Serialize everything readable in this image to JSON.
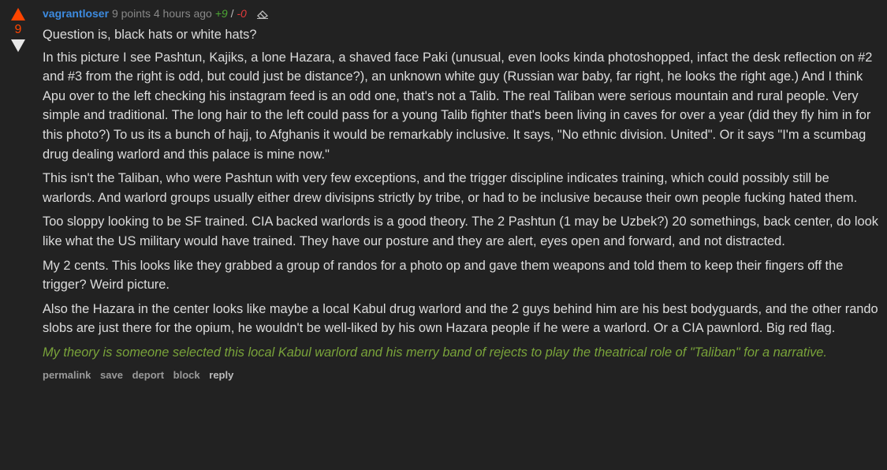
{
  "vote": {
    "score": "9",
    "upvote_color": "#ff4500",
    "downvote_color": "#e8e8e8"
  },
  "comment": {
    "author": "vagrantloser",
    "points": "9 points",
    "time": "4 hours ago",
    "plus": "+9",
    "separator": "/",
    "minus": "-0",
    "paragraphs": [
      "Question is, black hats or white hats?",
      "In this picture I see Pashtun, Kajiks, a lone Hazara, a shaved face Paki (unusual, even looks kinda photoshopped, infact the desk reflection on #2 and #3 from the right is odd, but could just be distance?), an unknown white guy (Russian war baby, far right, he looks the right age.) And I think Apu over to the left checking his instagram feed is an odd one, that's not a Talib. The real Taliban were serious mountain and rural people. Very simple and traditional. The long hair to the left could pass for a young Talib fighter that's been living in caves for over a year (did they fly him in for this photo?) To us its a bunch of hajj, to Afghanis it would be remarkably inclusive. It says, \"No ethnic division. United\". Or it says \"I'm a scumbag drug dealing warlord and this palace is mine now.\"",
      "This isn't the Taliban, who were Pashtun with very few exceptions, and the trigger discipline indicates training, which could possibly still be warlords. And warlord groups usually either drew divisipns strictly by tribe, or had to be inclusive because their own people fucking hated them.",
      "Too sloppy looking to be SF trained. CIA backed warlords is a good theory. The 2 Pashtun (1 may be Uzbek?) 20 somethings, back center, do look like what the US military would have trained. They have our posture and they are alert, eyes open and forward, and not distracted.",
      "My 2 cents. This looks like they grabbed a group of randos for a photo op and gave them weapons and told them to keep their fingers off the trigger? Weird picture.",
      "Also the Hazara in the center looks like maybe a local Kabul drug warlord and the 2 guys behind him are his best bodyguards, and the other rando slobs are just there for the opium, he wouldn't be well-liked by his own Hazara people if he were a warlord. Or a CIA pawnlord. Big red flag."
    ],
    "quote": "My theory is someone selected this local Kabul warlord and his merry band of rejects to play the theatrical role of \"Taliban\" for a narrative."
  },
  "buttons": {
    "permalink": "permalink",
    "save": "save",
    "deport": "deport",
    "block": "block",
    "reply": "reply"
  },
  "colors": {
    "background": "#222222",
    "author": "#3d8be0",
    "positive": "#4ca634",
    "negative": "#e33b3b",
    "quote": "#79a33a"
  }
}
